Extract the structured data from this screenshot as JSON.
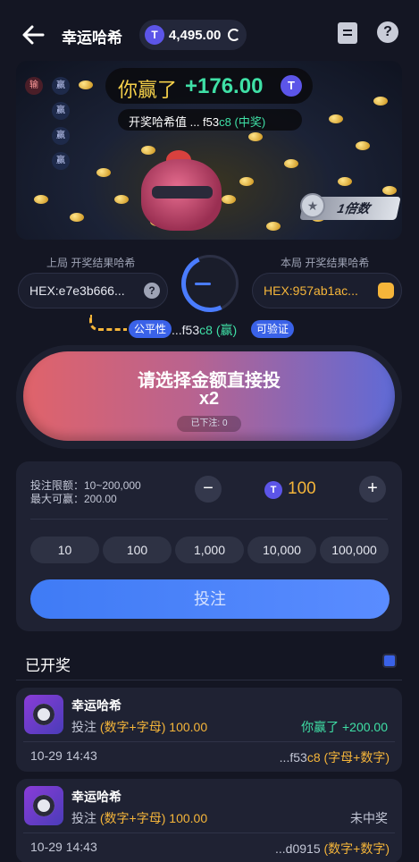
{
  "header": {
    "title": "幸运哈希",
    "balance": "4,495.00",
    "coin_glyph": "T"
  },
  "banner": {
    "win_text": "你赢了",
    "win_amount": "+176.00",
    "hash_label": "开奖哈希值 ... f53",
    "hash_highlight": "c8",
    "hash_result": "(中奖)",
    "rank_text": "1倍数",
    "side_badges": [
      {
        "label": "输",
        "type": "lose"
      },
      {
        "label": "赢",
        "type": "win"
      },
      {
        "label": "赢",
        "type": "win"
      },
      {
        "label": "赢",
        "type": "win"
      },
      {
        "label": "赢",
        "type": "win"
      }
    ]
  },
  "hashes": {
    "prev_label": "上局 开奖结果哈希",
    "prev_value": "HEX:e7e3b666...",
    "cur_label": "本局 开奖结果哈希",
    "cur_value": "HEX:957ab1ac...",
    "fair_label": "公平性",
    "fair_hash_prefix": "...f53",
    "fair_hash_highlight": "c8",
    "fair_hash_suffix": "(赢)",
    "verify_label": "可验证"
  },
  "main_button": {
    "line1": "请选择金额直接投",
    "line2": "x2",
    "placed": "已下注: 0"
  },
  "bet_panel": {
    "limit": "投注限额：10~200,000",
    "max_win": "最大可赢：200.00",
    "amount": "100",
    "minus": "−",
    "plus": "+",
    "chips": [
      "10",
      "100",
      "1,000",
      "10,000",
      "100,000"
    ],
    "bet_label": "投注"
  },
  "history": {
    "title": "已开奖",
    "records": [
      {
        "name": "幸运哈希",
        "bet_prefix": "投注",
        "bet_type": "(数字+字母) 100.00",
        "result": "你赢了 +200.00",
        "result_color": "#3fe0a6",
        "time": "10-29 14:43",
        "hash_prefix": "...f53",
        "hash_highlight": "c8",
        "hash_suffix": "(字母+数字)"
      },
      {
        "name": "幸运哈希",
        "bet_prefix": "投注",
        "bet_type": "(数字+字母) 100.00",
        "result": "未中奖",
        "result_color": "#c3c7d6",
        "time": "10-29 14:43",
        "hash_prefix": "...d0915",
        "hash_highlight": "",
        "hash_suffix": "(数字+数字)"
      }
    ]
  },
  "colors": {
    "accent_blue": "#3f7bf5",
    "win_green": "#3fe0a6",
    "gold": "#f5b53a",
    "background": "#141623"
  },
  "icons": [
    "back-arrow-icon",
    "coin-icon",
    "refresh-icon",
    "document-icon",
    "help-icon",
    "question-icon",
    "copy-icon",
    "gauge-icon",
    "star-icon"
  ]
}
